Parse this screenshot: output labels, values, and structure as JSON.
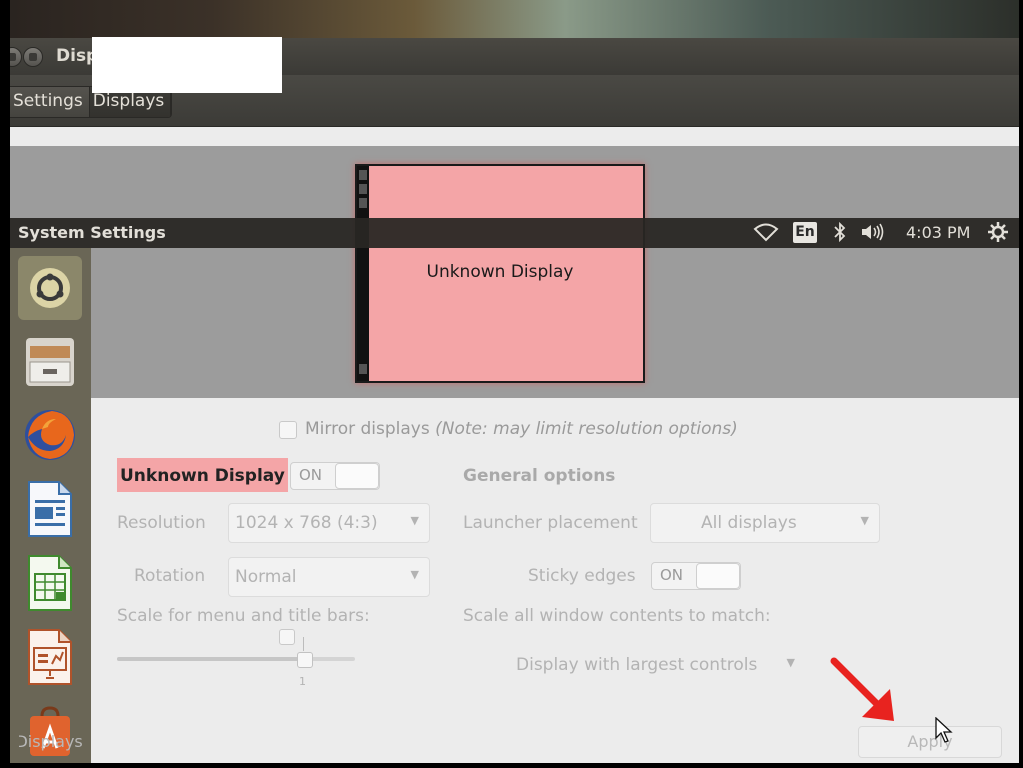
{
  "window": {
    "title": "Displays"
  },
  "breadcrumb": {
    "items": [
      "Settings",
      "Displays"
    ]
  },
  "top_panel": {
    "title": "System Settings",
    "keyboard_layout": "En",
    "clock": "4:03 PM"
  },
  "launcher": {
    "items": [
      "ubuntu-dash",
      "files",
      "firefox",
      "libreoffice-writer",
      "libreoffice-calc",
      "libreoffice-impress",
      "ubuntu-software-center"
    ]
  },
  "preview": {
    "monitor_label": "Unknown Display",
    "monitor_color": "#f4a5a7"
  },
  "mirror": {
    "label": "Mirror displays",
    "note": "(Note: may limit resolution options)"
  },
  "display": {
    "name": "Unknown Display",
    "switch_label": "ON",
    "resolution_label": "Resolution",
    "resolution_value": "1024 x 768 (4:3)",
    "rotation_label": "Rotation",
    "rotation_value": "Normal",
    "scale_label": "Scale for menu and title bars:",
    "scale_value": "1"
  },
  "general": {
    "heading": "General options",
    "launcher_label": "Launcher placement",
    "launcher_value": "All displays",
    "sticky_label": "Sticky edges",
    "sticky_switch": "ON",
    "scale_all_label": "Scale all window contents to match:",
    "scale_all_value": "Display with largest controls"
  },
  "footer": {
    "detect_label": "Detect Displays",
    "apply_label": "Apply"
  },
  "colors": {
    "accent_arrow": "#e8231f",
    "highlight": "#f4a5a7"
  }
}
